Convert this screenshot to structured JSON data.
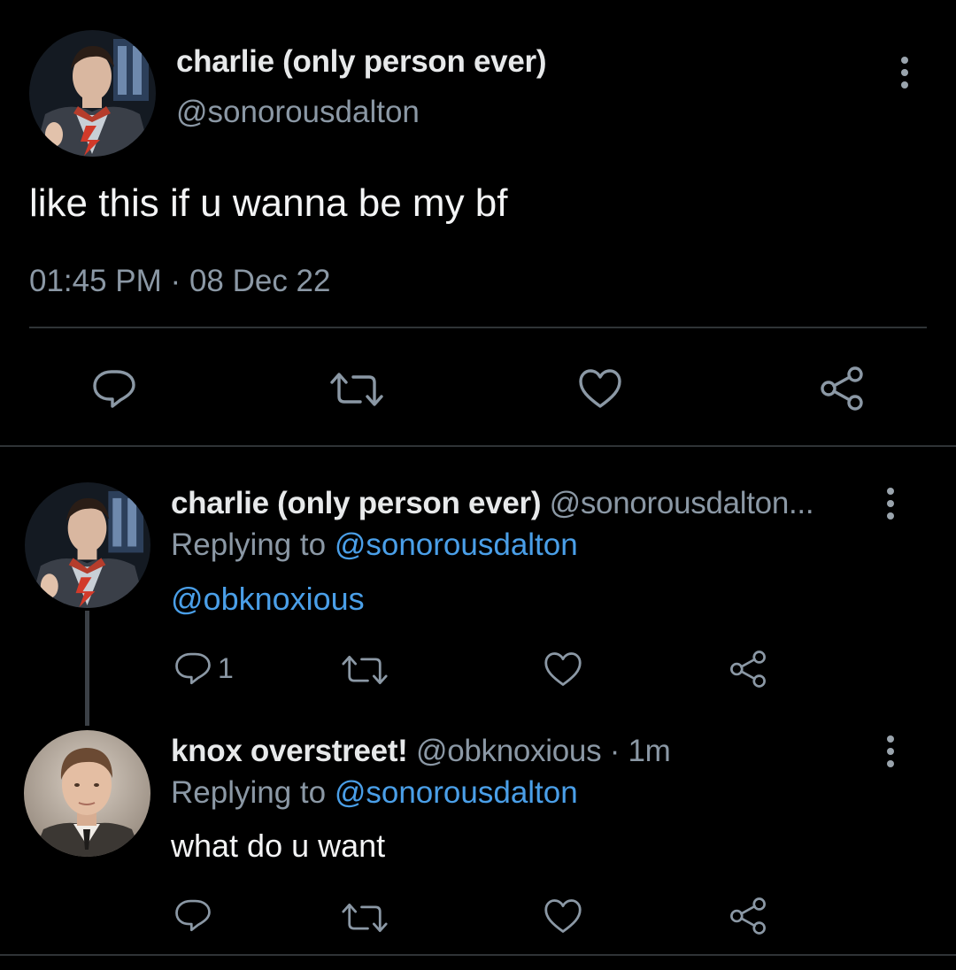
{
  "main_tweet": {
    "display_name": "charlie (only person ever)",
    "handle": "@sonorousdalton",
    "text": "like this if u wanna be my bf",
    "time": "01:45 PM",
    "separator": "·",
    "date": "08 Dec 22",
    "avatar_icon": "avatar-charlie"
  },
  "reply_1": {
    "display_name": "charlie (only person ever)",
    "handle": "@sonorousdalton...",
    "replying_to_label": "Replying to",
    "replying_to_handle": "@sonorousdalton",
    "text": "@obknoxious",
    "reply_count": "1"
  },
  "reply_2": {
    "display_name": "knox overstreet!",
    "handle": "@obknoxious",
    "separator": "·",
    "time": "1m",
    "replying_to_label": "Replying to",
    "replying_to_handle": "@sonorousdalton",
    "text": "what do u want"
  },
  "icons": {
    "reply": "reply-icon",
    "retweet": "retweet-icon",
    "like": "heart-icon",
    "share": "share-icon",
    "more": "more-vertical-icon"
  },
  "colors": {
    "background": "#000000",
    "text": "#e7e9ea",
    "muted": "#8b98a5",
    "link": "#4a9fe8",
    "divider": "#2f3336"
  }
}
